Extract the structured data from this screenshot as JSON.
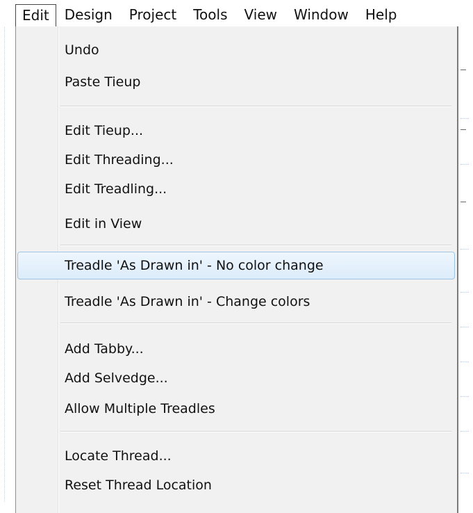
{
  "menubar": {
    "items": [
      {
        "label": "Edit"
      },
      {
        "label": "Design"
      },
      {
        "label": "Project"
      },
      {
        "label": "Tools"
      },
      {
        "label": "View"
      },
      {
        "label": "Window"
      },
      {
        "label": "Help"
      }
    ]
  },
  "edit_menu": {
    "items": [
      {
        "label": "Undo"
      },
      {
        "label": "Paste Tieup"
      },
      {
        "label": "Edit Tieup..."
      },
      {
        "label": "Edit Threading..."
      },
      {
        "label": "Edit Treadling..."
      },
      {
        "label": "Edit in View"
      },
      {
        "label": "Treadle 'As Drawn in' -  No color change",
        "highlighted": true
      },
      {
        "label": "Treadle 'As Drawn in' - Change colors"
      },
      {
        "label": "Add Tabby..."
      },
      {
        "label": "Add Selvedge..."
      },
      {
        "label": "Allow Multiple Treadles"
      },
      {
        "label": "Locate Thread..."
      },
      {
        "label": "Reset Thread Location"
      }
    ]
  },
  "colors": {
    "menu_background": "#f1f1f1",
    "highlight_border": "#9ec4e3",
    "highlight_fill": "#dcecfa"
  }
}
